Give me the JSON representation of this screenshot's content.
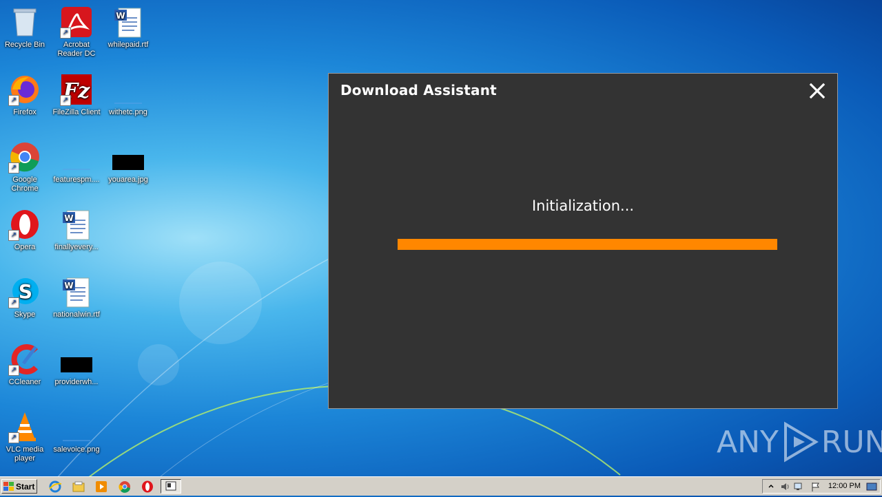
{
  "desktop": {
    "icons": [
      {
        "label": "Recycle Bin"
      },
      {
        "label": "Acrobat Reader DC"
      },
      {
        "label": "whilepaid.rtf"
      },
      {
        "label": "Firefox"
      },
      {
        "label": "FileZilla Client"
      },
      {
        "label": "withetc.png"
      },
      {
        "label": "Google Chrome"
      },
      {
        "label": "featurespm...."
      },
      {
        "label": "youarea.jpg"
      },
      {
        "label": "Opera"
      },
      {
        "label": "finallyevery..."
      },
      {
        "label": "Skype"
      },
      {
        "label": "nationalwin.rtf"
      },
      {
        "label": "CCleaner"
      },
      {
        "label": "providerwh..."
      },
      {
        "label": "VLC media player"
      },
      {
        "label": "salevoice.png"
      }
    ]
  },
  "dialog": {
    "title": "Download Assistant",
    "status_text": "Initialization...",
    "progress_percent": 100,
    "accent_color": "#ff8700",
    "background_color": "#333333"
  },
  "watermark": {
    "text_left": "ANY",
    "text_right": "RUN"
  },
  "taskbar": {
    "start_label": "Start",
    "clock": "12:00 PM",
    "quick_launch": [
      "ie-icon",
      "explorer-icon",
      "media-player-icon",
      "chrome-icon",
      "opera-icon"
    ]
  }
}
